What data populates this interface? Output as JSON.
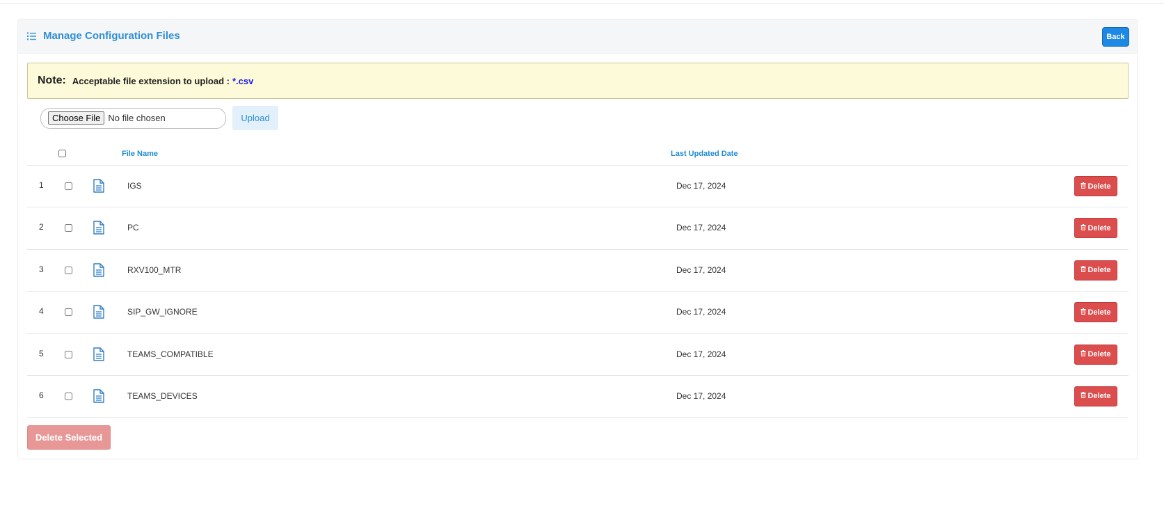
{
  "header": {
    "title": "Manage Configuration Files",
    "back_label": "Back"
  },
  "note": {
    "label": "Note:",
    "text": "Acceptable file extension to upload :",
    "extension": "*.csv"
  },
  "upload": {
    "choose_label": "Choose File",
    "status": "No file chosen",
    "upload_label": "Upload"
  },
  "table": {
    "columns": {
      "file_name": "File Name",
      "last_updated": "Last Updated Date"
    },
    "rows": [
      {
        "num": "1",
        "name": "IGS",
        "date": "Dec 17, 2024",
        "action": "Delete"
      },
      {
        "num": "2",
        "name": "PC",
        "date": "Dec 17, 2024",
        "action": "Delete"
      },
      {
        "num": "3",
        "name": "RXV100_MTR",
        "date": "Dec 17, 2024",
        "action": "Delete"
      },
      {
        "num": "4",
        "name": "SIP_GW_IGNORE",
        "date": "Dec 17, 2024",
        "action": "Delete"
      },
      {
        "num": "5",
        "name": "TEAMS_COMPATIBLE",
        "date": "Dec 17, 2024",
        "action": "Delete"
      },
      {
        "num": "6",
        "name": "TEAMS_DEVICES",
        "date": "Dec 17, 2024",
        "action": "Delete"
      }
    ]
  },
  "footer": {
    "delete_selected_label": "Delete Selected"
  },
  "colors": {
    "accent": "#1e88e5",
    "danger": "#dc4d4d",
    "note_bg": "#fcfad9"
  }
}
